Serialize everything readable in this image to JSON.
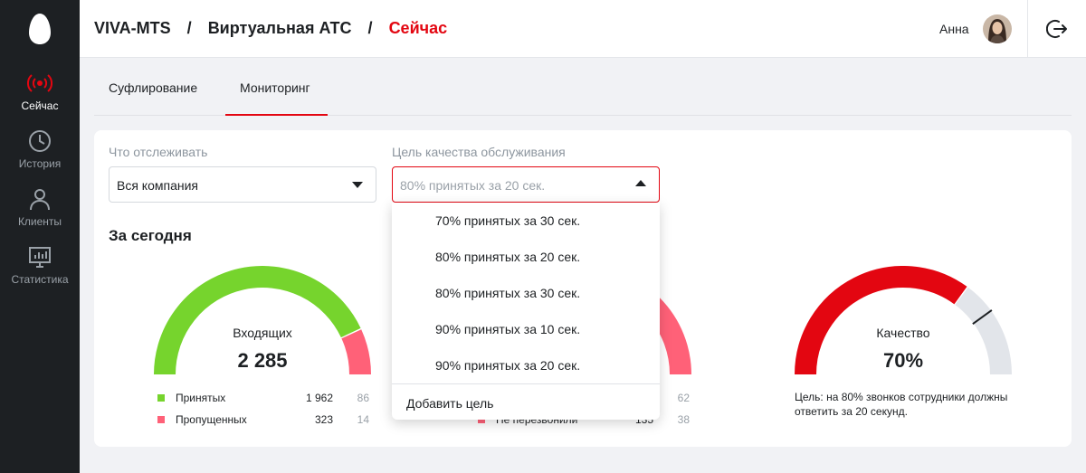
{
  "sidebar": {
    "logo_icon": "egg-logo-icon",
    "items": [
      {
        "label": "Сейчас",
        "icon": "broadcast-icon",
        "active": true
      },
      {
        "label": "История",
        "icon": "clock-icon",
        "active": false
      },
      {
        "label": "Клиенты",
        "icon": "user-icon",
        "active": false
      },
      {
        "label": "Статистика",
        "icon": "monitor-chart-icon",
        "active": false
      }
    ]
  },
  "header": {
    "breadcrumbs": [
      "VIVA-MTS",
      "Виртуальная АТС",
      "Сейчас"
    ],
    "separator": "/",
    "user_name": "Анна",
    "logout_icon": "logout-icon"
  },
  "tabs": [
    {
      "label": "Суфлирование",
      "active": false
    },
    {
      "label": "Мониторинг",
      "active": true
    }
  ],
  "filters": {
    "track_label": "Что отслеживать",
    "track_value": "Вся компания",
    "goal_label": "Цель качества обслуживания",
    "goal_value": "80% принятых за 20 сек."
  },
  "section_title": "За сегодня",
  "gauges": {
    "incoming": {
      "label": "Входящих",
      "value": "2 285",
      "accepted_fraction": 0.86,
      "legend": [
        {
          "label": "Принятых",
          "count": "1 962",
          "percent": "86"
        },
        {
          "label": "Пропущенных",
          "count": "323",
          "percent": "14"
        }
      ]
    },
    "middle": {
      "legend_partial": [
        {
          "label": "Не перезвонили",
          "count": "135",
          "percent": "38"
        }
      ],
      "percent_top": "62"
    },
    "quality": {
      "label": "Качество",
      "value": "70%",
      "value_fraction": 0.7,
      "target_fraction": 0.8,
      "note": "Цель: на 80% звонков сотрудники должны ответить за 20 секунд."
    }
  },
  "dropdown": {
    "options": [
      "70% принятых за 30 сек.",
      "80% принятых за 20 сек.",
      "80% принятых за 30 сек.",
      "90% принятых за 10 сек.",
      "90% принятых за 20 сек."
    ],
    "add_label": "Добавить цель"
  },
  "colors": {
    "accent": "#e30611",
    "green": "#76d42d",
    "pink": "#ff6178",
    "grey_arc": "#e2e5ea",
    "sidebar_bg": "#1d2023"
  }
}
